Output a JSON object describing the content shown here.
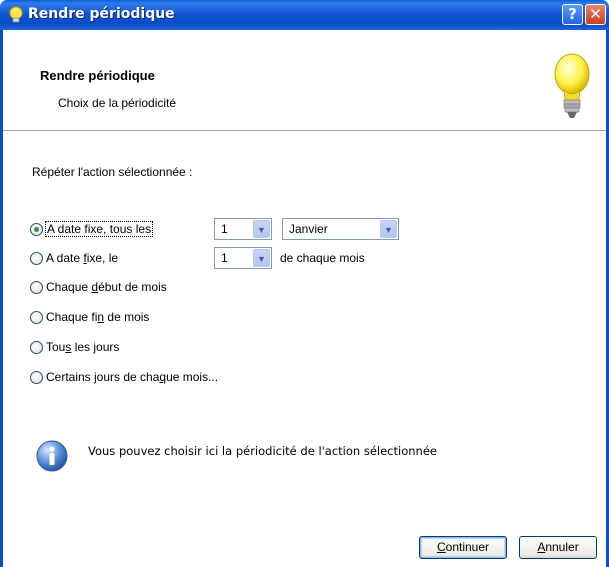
{
  "window": {
    "title": "Rendre périodique",
    "help_glyph": "?",
    "close_glyph": "✕"
  },
  "header": {
    "title": "Rendre périodique",
    "subtitle": "Choix de la périodicité",
    "icon": "lightbulb-icon"
  },
  "prompt": "Répéter l'action sélectionnée :",
  "options": {
    "fixed_date_every": {
      "label": "A date fixe, tous les",
      "checked": true
    },
    "fixed_date_on": {
      "label_pre": "A date ",
      "label_u": "f",
      "label_post": "ixe, le",
      "checked": false
    },
    "start_of_month": {
      "label_pre": "Chaque ",
      "label_u": "d",
      "label_post": "ébut de mois",
      "checked": false
    },
    "end_of_month": {
      "label_pre": "Chaque fi",
      "label_u": "n",
      "label_post": " de mois",
      "checked": false
    },
    "every_day": {
      "label_pre": "Tou",
      "label_u": "s",
      "label_post": " les jours",
      "checked": false
    },
    "some_days": {
      "label_pre": "Certains jours de cha",
      "label_u": "q",
      "label_post": "ue mois...",
      "checked": false
    }
  },
  "combos": {
    "every_count": {
      "value": "1"
    },
    "every_month": {
      "value": "Janvier"
    },
    "day_of_month": {
      "value": "1"
    }
  },
  "each_month_text": "de chaque mois",
  "info": {
    "icon": "info-icon",
    "text": "Vous pouvez choisir ici la périodicité de l'action sélectionnée"
  },
  "buttons": {
    "continue_u": "C",
    "continue_rest": "ontinuer",
    "cancel_u": "A",
    "cancel_rest": "nnuler"
  },
  "colors": {
    "titlebar": "#0a4cc7",
    "radio_check": "#2a9d29"
  }
}
